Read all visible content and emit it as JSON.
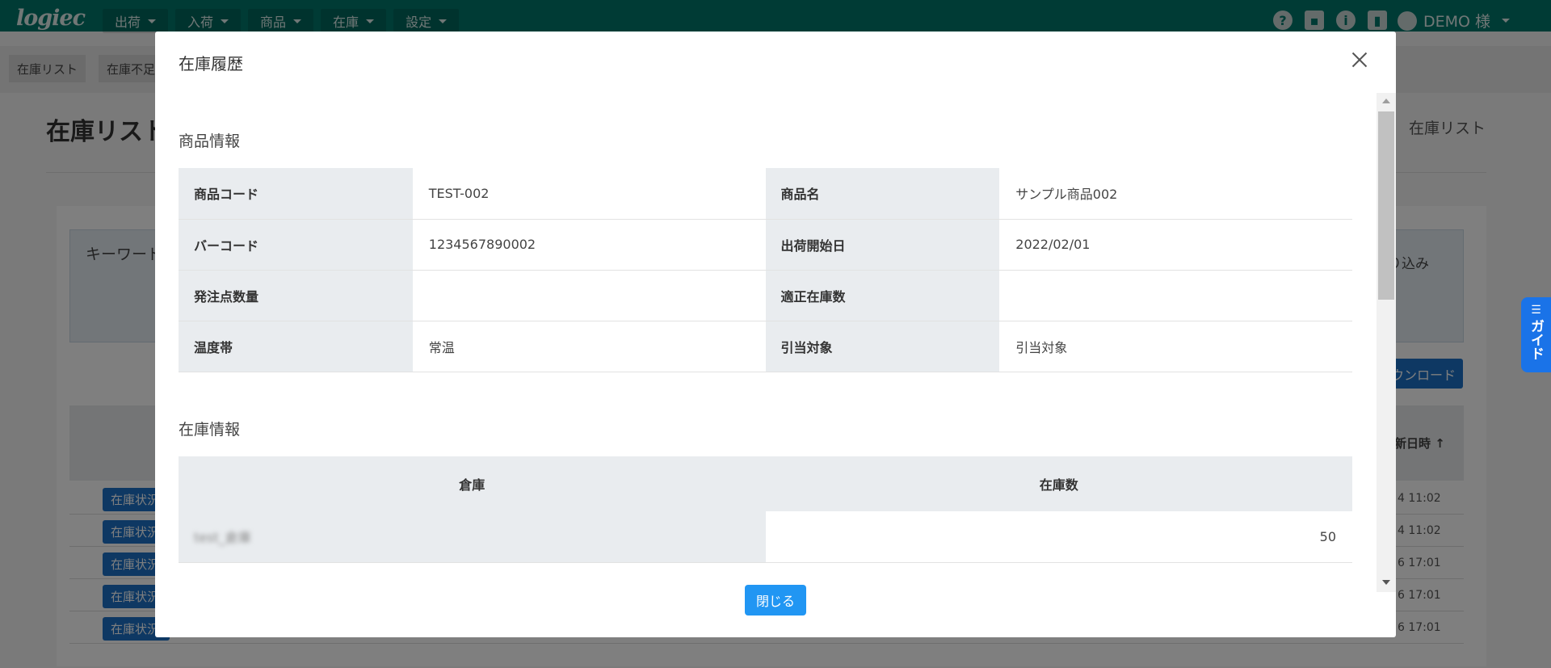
{
  "app": {
    "logo": "logiec",
    "nav": [
      "出荷",
      "入荷",
      "商品",
      "在庫",
      "設定"
    ],
    "user": "DEMO 様"
  },
  "background": {
    "subtabs": [
      "在庫リスト",
      "在庫不足"
    ],
    "page_title": "在庫リスト",
    "breadcrumb": "在庫リスト",
    "keyword_label": "キーワード",
    "refine_label": "り込み",
    "download_label": "ウンロード",
    "sort_label": "新日時",
    "row_button": "在庫状況",
    "row_times": [
      "4 11:02",
      "4 11:02",
      "6 17:01",
      "6 17:01",
      "6 17:01"
    ]
  },
  "guide": {
    "label": "ガイド"
  },
  "modal": {
    "title": "在庫履歴",
    "product_section": "商品情報",
    "product_rows": [
      {
        "label1": "商品コード",
        "value1": "TEST-002",
        "label2": "商品名",
        "value2": "サンプル商品002"
      },
      {
        "label1": "バーコード",
        "value1": "1234567890002",
        "label2": "出荷開始日",
        "value2": "2022/02/01"
      },
      {
        "label1": "発注点数量",
        "value1": "",
        "label2": "適正在庫数",
        "value2": ""
      },
      {
        "label1": "温度帯",
        "value1": "常温",
        "label2": "引当対象",
        "value2": "引当対象"
      }
    ],
    "stock_section": "在庫情報",
    "stock_headers": {
      "warehouse": "倉庫",
      "quantity": "在庫数"
    },
    "stock_rows": [
      {
        "warehouse": "test_倉庫",
        "quantity": "50"
      }
    ],
    "close_button": "閉じる"
  },
  "colors": {
    "header": "#00766a",
    "primary_button": "#2196f3",
    "guide_tab": "#1a73e8",
    "label_cell": "#e9ecef"
  },
  "icons": [
    "help-icon",
    "briefcase-icon",
    "info-icon",
    "chart-icon",
    "account-icon",
    "close-icon",
    "guide-icon"
  ]
}
